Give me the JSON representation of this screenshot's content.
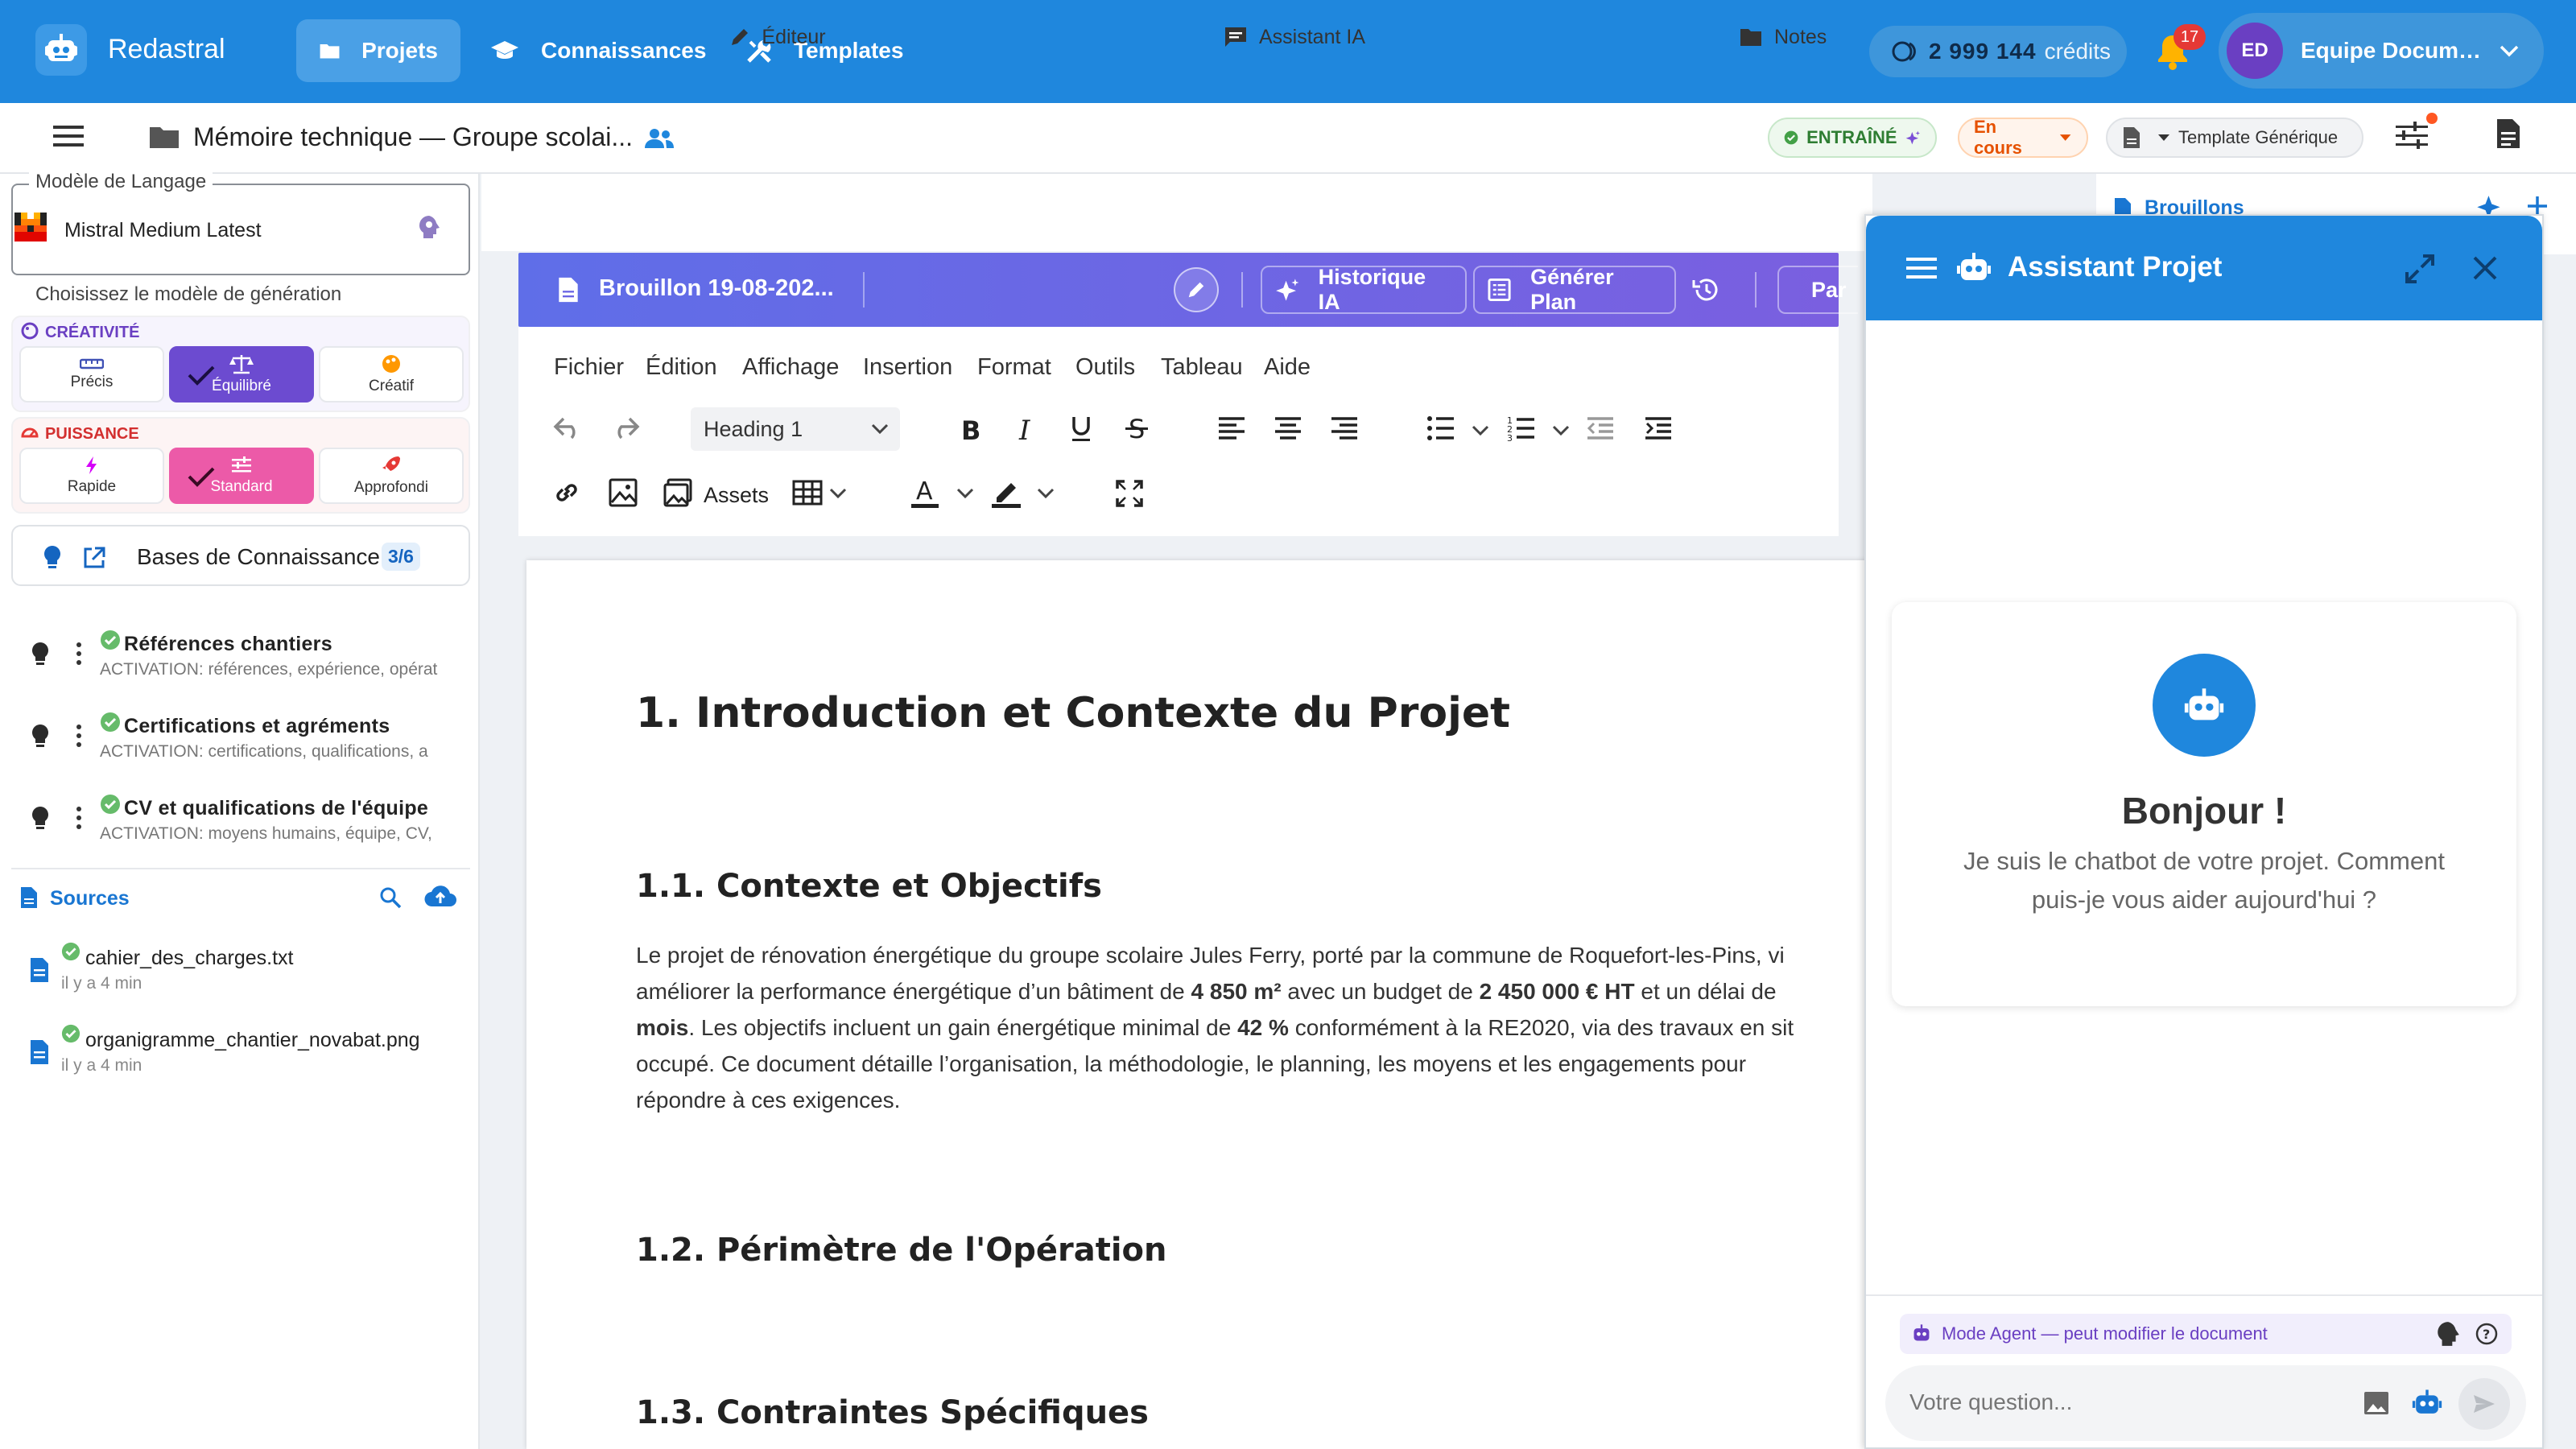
{
  "topbar": {
    "app_name": "Redastral",
    "nav": [
      {
        "label": "Projets",
        "icon": "folder-icon",
        "active": true
      },
      {
        "label": "Connaissances",
        "icon": "graduation-cap-icon"
      },
      {
        "label": "Templates",
        "icon": "tools-icon"
      }
    ],
    "credits_value": "2 999 144",
    "credits_unit": "crédits",
    "notifications_count": "17",
    "user_initials": "ED",
    "user_name": "Equipe Documen..."
  },
  "subbar": {
    "doc_title": "Mémoire technique — Groupe scolai...",
    "status_trained": "ENTRAÎNÉ",
    "status_progress": "En cours",
    "template": "Template Générique"
  },
  "left": {
    "model_legend": "Modèle de Langage",
    "model_name": "Mistral Medium Latest",
    "model_hint": "Choisissez le modèle de génération",
    "creativity_label": "CRÉATIVITÉ",
    "creativity_options": [
      "Précis",
      "Équilibré",
      "Créatif"
    ],
    "power_label": "PUISSANCE",
    "power_options": [
      "Rapide",
      "Standard",
      "Approfondi"
    ],
    "kb_label": "Bases de Connaissance",
    "kb_count": "3/6",
    "kb_items": [
      {
        "title": "Références chantiers",
        "sub": "ACTIVATION: références, expérience, opérat"
      },
      {
        "title": "Certifications et agréments",
        "sub": "ACTIVATION: certifications, qualifications, a"
      },
      {
        "title": "CV et qualifications de l'équipe",
        "sub": "ACTIVATION: moyens humains, équipe, CV,"
      }
    ],
    "sources_label": "Sources",
    "sources": [
      {
        "name": "cahier_des_charges.txt",
        "time": "il y a 4 min"
      },
      {
        "name": "organigramme_chantier_novabat.png",
        "time": "il y a 4 min"
      }
    ]
  },
  "editor": {
    "tabs": [
      "Éditeur",
      "Assistant IA",
      "Notes"
    ],
    "right_tab": "Brouillons",
    "draft_title": "Brouillon 19-08-202...",
    "btn_history": "Historique IA",
    "btn_plan": "Générer Plan",
    "btn_share": "Par",
    "menu": [
      "Fichier",
      "Édition",
      "Affichage",
      "Insertion",
      "Format",
      "Outils",
      "Tableau",
      "Aide"
    ],
    "block_format": "Heading 1",
    "assets_label": "Assets"
  },
  "document": {
    "h1": "1. Introduction et Contexte du Projet",
    "h2_a": "1.1. Contexte et Objectifs",
    "p1": "Le projet de rénovation énergétique du groupe scolaire Jules Ferry, porté par la commune de Roquefort-les-Pins, vi",
    "p2a": "améliorer la performance énergétique d’un bâtiment de ",
    "p2b": "4 850 m²",
    "p2c": " avec un budget de ",
    "p2d": "2 450 000 € HT",
    "p2e": " et un délai de",
    "p3a": "mois",
    "p3b": ". Les objectifs incluent un gain énergétique minimal de ",
    "p3c": "42 %",
    "p3d": " conformément à la RE2020, via des travaux en sit",
    "p4": "occupé. Ce document détaille l’organisation, la méthodologie, le planning, les moyens et les engagements pour",
    "p5": "répondre à ces exigences.",
    "h2_b": "1.2. Périmètre de l'Opération",
    "h2_c": "1.3. Contraintes Spécifiques"
  },
  "chat": {
    "title": "Assistant Projet",
    "greeting": "Bonjour !",
    "greeting_sub": "Je suis le chatbot de votre projet. Comment puis-je vous aider aujourd'hui ?",
    "agent_mode": "Mode Agent — peut modifier le document",
    "input_placeholder": "Votre question..."
  }
}
